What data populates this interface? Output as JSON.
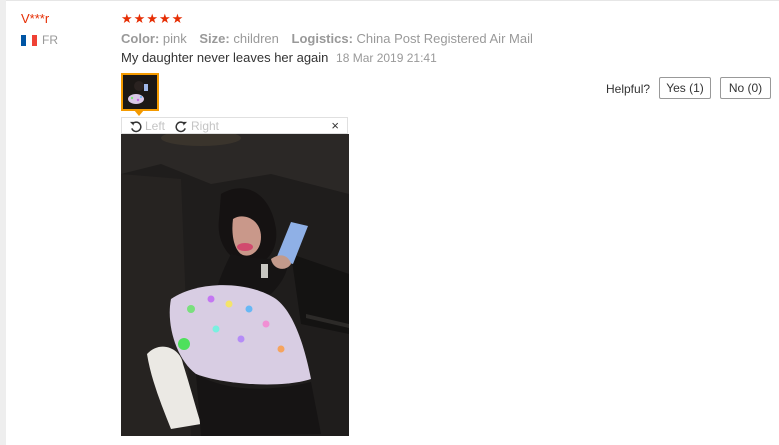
{
  "review": {
    "user": "V***r",
    "country": "FR",
    "rating_stars": [
      "★",
      "★",
      "★",
      "★",
      "★"
    ],
    "rating": 5,
    "attributes": [
      {
        "key": "Color:",
        "value": "pink"
      },
      {
        "key": "Size:",
        "value": "children"
      },
      {
        "key": "Logistics:",
        "value": "China Post Registered Air Mail"
      }
    ],
    "text": "My daughter never leaves her again",
    "date": "18 Mar 2019 21:41"
  },
  "image_viewer": {
    "rotate_left_label": "Left",
    "rotate_right_label": "Right",
    "close_glyph": "×"
  },
  "helpful": {
    "label": "Helpful?",
    "yes_label": "Yes (1)",
    "no_label": "No (0)"
  },
  "colors": {
    "accent": "#e62e04",
    "thumb_border": "#f49a00",
    "muted": "#999999"
  },
  "icons": [
    "flag-fr-icon",
    "star-icon",
    "rotate-left-icon",
    "rotate-right-icon",
    "close-icon"
  ]
}
